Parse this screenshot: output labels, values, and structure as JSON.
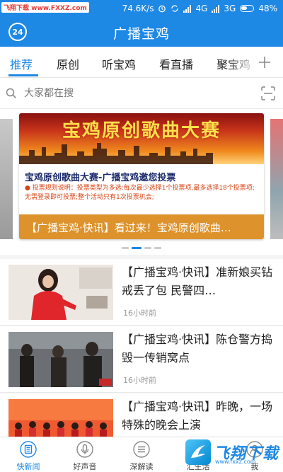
{
  "status_bar": {
    "watermark": "飞翔下载 www.FXXZ.com",
    "speed": "74.6K/s",
    "network_left": "4G",
    "network_right": "3G",
    "battery": "48%"
  },
  "header": {
    "logo_text": "24",
    "title": "广播宝鸡"
  },
  "tabs": [
    "推荐",
    "原创",
    "听宝鸡",
    "看直播",
    "聚宝鸡"
  ],
  "active_tab_index": 0,
  "search": {
    "placeholder": "大家都在搜"
  },
  "banner": {
    "headline": "宝鸡原创歌曲大赛",
    "subtitle": "宝鸡原创歌曲大赛-广播宝鸡邀您投票",
    "description": "● 投票规则说明：投票类型为多选:每次最少选择1个投票项,最多选择18个投票项;无需登录即可投票;整个活动只有1次投票机会;",
    "caption": "【广播宝鸡·快讯】看过来！宝鸡原创歌曲…",
    "page_count": 4,
    "active_page": 1
  },
  "news": [
    {
      "title": "【广播宝鸡·快讯】准新娘买钻戒丢了包 民警四…",
      "time": "16小时前"
    },
    {
      "title": "【广播宝鸡·快讯】陈仓警方捣毁一传销窝点",
      "time": "16小时前"
    },
    {
      "title": "【广播宝鸡·快讯】昨晚，一场特殊的晚会上演",
      "time": ""
    }
  ],
  "bottom_nav": [
    {
      "label": "快新闻",
      "icon": "news-icon"
    },
    {
      "label": "好声音",
      "icon": "microphone-icon"
    },
    {
      "label": "深解读",
      "icon": "list-icon"
    },
    {
      "label": "汇生活",
      "icon": "life-icon"
    },
    {
      "label": "我",
      "icon": "user-icon"
    }
  ],
  "active_nav_index": 0,
  "brand_stamp": {
    "text": "飞翔下载",
    "url": "www.fxxz.com"
  },
  "colors": {
    "primary": "#1e88e5",
    "banner_caption": "#d98614"
  }
}
